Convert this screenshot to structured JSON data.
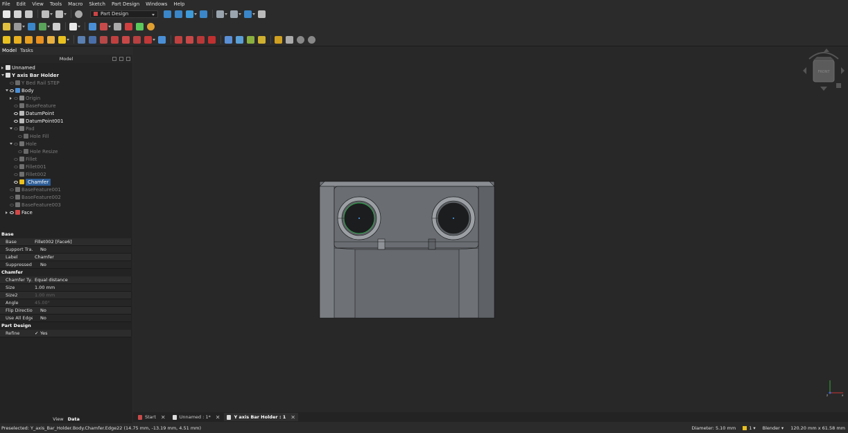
{
  "menu": [
    "File",
    "Edit",
    "View",
    "Tools",
    "Macro",
    "Sketch",
    "Part Design",
    "Windows",
    "Help"
  ],
  "workbench": {
    "selected": "Part Design",
    "accent": "#c0392b"
  },
  "panel": {
    "tabs": {
      "model": "Model",
      "tasks": "Tasks"
    },
    "tree_header": "Model",
    "tree": [
      {
        "label": "Unnamed",
        "depth": 0,
        "state": "closed",
        "icon": "document-icon",
        "dim": false,
        "selected": false
      },
      {
        "label": "Y axis Bar Holder",
        "depth": 0,
        "state": "open",
        "icon": "document-icon",
        "dim": false,
        "selected": false,
        "bold": true
      },
      {
        "label": "Y Bed Rail STEP",
        "depth": 1,
        "state": "none",
        "icon": "part-icon",
        "dim": true,
        "selected": false
      },
      {
        "label": "Body",
        "depth": 1,
        "state": "open",
        "icon": "body-icon",
        "dim": false,
        "selected": false,
        "eye": true
      },
      {
        "label": "Origin",
        "depth": 2,
        "state": "closed",
        "icon": "origin-icon",
        "dim": true,
        "selected": false
      },
      {
        "label": "BaseFeature",
        "depth": 2,
        "state": "none",
        "icon": "feature-icon",
        "dim": true,
        "selected": false
      },
      {
        "label": "DatumPoint",
        "depth": 2,
        "state": "none",
        "icon": "datum-point-icon",
        "dim": false,
        "selected": false,
        "eye": true
      },
      {
        "label": "DatumPoint001",
        "depth": 2,
        "state": "none",
        "icon": "datum-point-icon",
        "dim": false,
        "selected": false,
        "eye": true
      },
      {
        "label": "Pad",
        "depth": 2,
        "state": "open",
        "icon": "pad-icon",
        "dim": true,
        "selected": false
      },
      {
        "label": "Hole Fill",
        "depth": 3,
        "state": "none",
        "icon": "sketch-icon",
        "dim": true,
        "selected": false
      },
      {
        "label": "Hole",
        "depth": 2,
        "state": "open",
        "icon": "hole-icon",
        "dim": true,
        "selected": false
      },
      {
        "label": "Hole Resize",
        "depth": 3,
        "state": "none",
        "icon": "sketch-icon",
        "dim": true,
        "selected": false
      },
      {
        "label": "Fillet",
        "depth": 2,
        "state": "none",
        "icon": "fillet-icon",
        "dim": true,
        "selected": false
      },
      {
        "label": "Fillet001",
        "depth": 2,
        "state": "none",
        "icon": "fillet-icon",
        "dim": true,
        "selected": false
      },
      {
        "label": "Fillet002",
        "depth": 2,
        "state": "none",
        "icon": "fillet-icon",
        "dim": true,
        "selected": false
      },
      {
        "label": "Chamfer",
        "depth": 2,
        "state": "none",
        "icon": "chamfer-icon",
        "dim": false,
        "selected": true,
        "eye": true
      },
      {
        "label": "BaseFeature001",
        "depth": 1,
        "state": "none",
        "icon": "feature-icon",
        "dim": true,
        "selected": false
      },
      {
        "label": "BaseFeature002",
        "depth": 1,
        "state": "none",
        "icon": "feature-icon",
        "dim": true,
        "selected": false
      },
      {
        "label": "BaseFeature003",
        "depth": 1,
        "state": "none",
        "icon": "feature-icon",
        "dim": true,
        "selected": false
      },
      {
        "label": "Face",
        "depth": 1,
        "state": "closed",
        "icon": "face-icon",
        "dim": false,
        "selected": false,
        "eye": true
      }
    ],
    "properties": [
      {
        "group": "Base",
        "rows": [
          {
            "key": "Base",
            "value": "Fillet002 [Face6]"
          },
          {
            "key": "Support Tra...",
            "value": "No"
          },
          {
            "key": "Label",
            "value": "Chamfer"
          },
          {
            "key": "Suppressed",
            "value": "No"
          }
        ]
      },
      {
        "group": "Chamfer",
        "rows": [
          {
            "key": "Chamfer Ty...",
            "value": "Equal distance"
          },
          {
            "key": "Size",
            "value": "1.00 mm"
          },
          {
            "key": "Size2",
            "value": "1.00 mm",
            "disabled": true
          },
          {
            "key": "Angle",
            "value": "45.00°",
            "disabled": true
          },
          {
            "key": "Flip Direction",
            "value": "No"
          },
          {
            "key": "Use All Edges",
            "value": "No"
          }
        ]
      },
      {
        "group": "Part Design",
        "rows": [
          {
            "key": "Refine",
            "value": "Yes",
            "checked": true
          }
        ]
      }
    ],
    "bottom_tabs": {
      "view": "View",
      "data": "Data"
    }
  },
  "navcube": {
    "face_label": "FRONT"
  },
  "doc_tabs": [
    {
      "label": "Start",
      "icon": "start-icon",
      "active": false
    },
    {
      "label": "Unnamed : 1*",
      "icon": "document-icon",
      "active": false
    },
    {
      "label": "Y axis Bar Holder : 1",
      "icon": "document-icon",
      "active": true
    }
  ],
  "status": {
    "message": "Preselected: Y_axis_Bar_Holder.Body.Chamfer.Edge22 (14.75 mm, -13.19 mm, 4.51 mm)",
    "diameter": "Diameter: 5.10 mm",
    "lights": "1",
    "navstyle": "Blender",
    "dimensions": "120.20 mm x 61.58 mm"
  },
  "colors": {
    "selection": "#2d5d96",
    "model": "#6e7277",
    "preselect": "#2ea84a"
  }
}
